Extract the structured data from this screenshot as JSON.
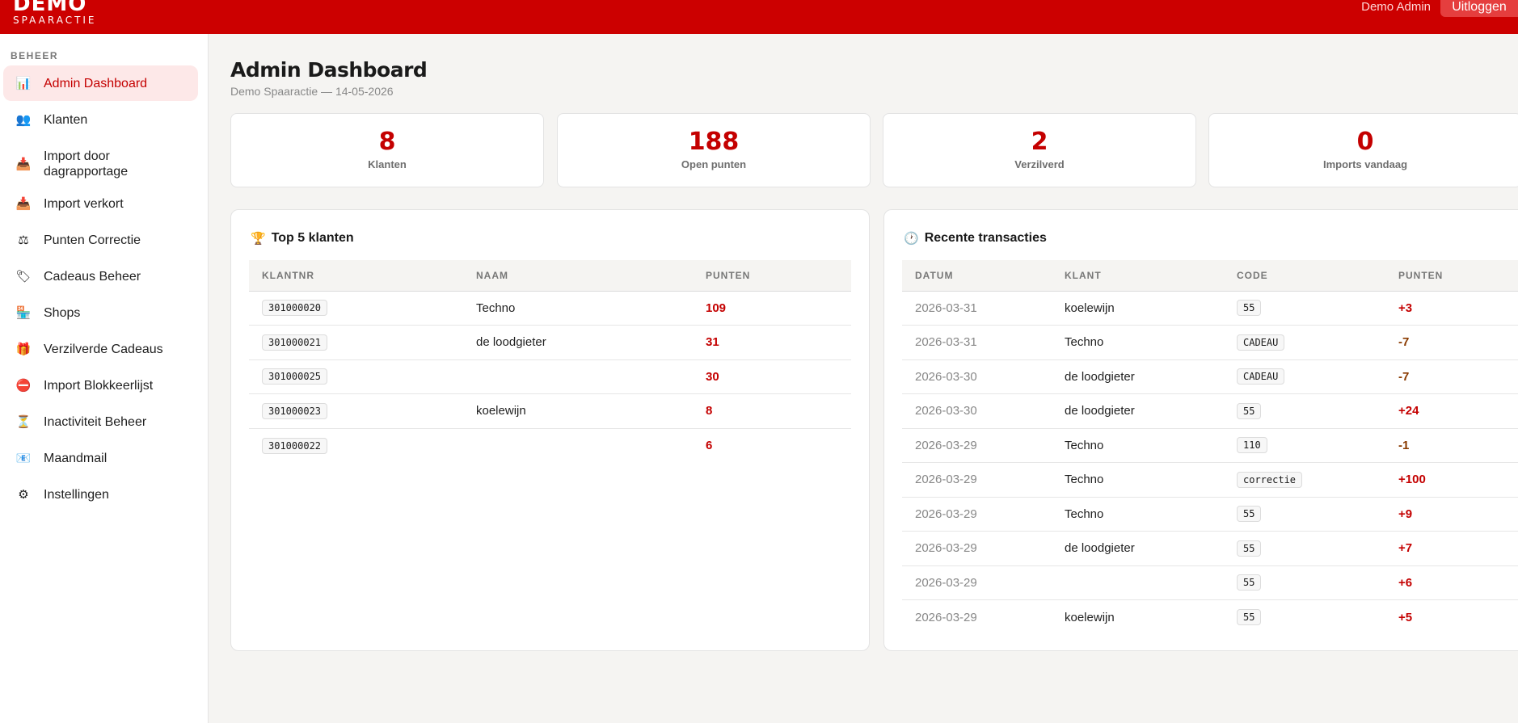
{
  "app": {
    "brand_name": "DEMO",
    "brand_subtitle": "SPAARACTIE",
    "user_name": "Demo Admin",
    "logout_label": "Uitloggen",
    "accent_color": "#cc0000"
  },
  "sidebar": {
    "heading": "BEHEER",
    "items": [
      {
        "label": "Admin Dashboard",
        "icon": "bar-chart-icon",
        "glyph": "📊",
        "active": true
      },
      {
        "label": "Klanten",
        "icon": "users-icon",
        "glyph": "👥"
      },
      {
        "label": "Import door dagrapportage",
        "icon": "inbox-tray-icon",
        "glyph": "📥"
      },
      {
        "label": "Import verkort",
        "icon": "inbox-tray-icon",
        "glyph": "📥"
      },
      {
        "label": "Punten Correctie",
        "icon": "balance-scale-icon",
        "glyph": "⚖"
      },
      {
        "label": "Cadeaus Beheer",
        "icon": "label-tag-icon",
        "glyph": "🏷"
      },
      {
        "label": "Shops",
        "icon": "shop-icon",
        "glyph": "🏪"
      },
      {
        "label": "Verzilverde Cadeaus",
        "icon": "gift-icon",
        "glyph": "🎁"
      },
      {
        "label": "Import Blokkeerlijst",
        "icon": "no-entry-icon",
        "glyph": "⛔"
      },
      {
        "label": "Inactiviteit Beheer",
        "icon": "hourglass-icon",
        "glyph": "⏳"
      },
      {
        "label": "Maandmail",
        "icon": "mail-icon",
        "glyph": "📧"
      },
      {
        "label": "Instellingen",
        "icon": "gear-icon",
        "glyph": "⚙"
      }
    ]
  },
  "page": {
    "title": "Admin Dashboard",
    "subtitle": "Demo Spaaractie — 14-05-2026"
  },
  "stats": [
    {
      "value": "8",
      "label": "Klanten"
    },
    {
      "value": "188",
      "label": "Open punten"
    },
    {
      "value": "2",
      "label": "Verzilverd"
    },
    {
      "value": "0",
      "label": "Imports vandaag"
    }
  ],
  "top_klanten": {
    "title": "Top 5 klanten",
    "icon": "trophy-icon",
    "columns": [
      "KLANTNR",
      "NAAM",
      "PUNTEN"
    ],
    "rows": [
      {
        "klantnr": "301000020",
        "naam": "Techno",
        "punten": "109"
      },
      {
        "klantnr": "301000021",
        "naam": "de loodgieter",
        "punten": "31"
      },
      {
        "klantnr": "301000025",
        "naam": "",
        "punten": "30"
      },
      {
        "klantnr": "301000023",
        "naam": "koelewijn",
        "punten": "8"
      },
      {
        "klantnr": "301000022",
        "naam": "",
        "punten": "6"
      }
    ]
  },
  "transacties": {
    "title": "Recente transacties",
    "icon": "clock-icon",
    "columns": [
      "DATUM",
      "KLANT",
      "CODE",
      "PUNTEN"
    ],
    "rows": [
      {
        "datum": "2026-03-31",
        "klant": "koelewijn",
        "code": "55",
        "punten": "+3"
      },
      {
        "datum": "2026-03-31",
        "klant": "Techno",
        "code": "CADEAU",
        "punten": "-7"
      },
      {
        "datum": "2026-03-30",
        "klant": "de loodgieter",
        "code": "CADEAU",
        "punten": "-7"
      },
      {
        "datum": "2026-03-30",
        "klant": "de loodgieter",
        "code": "55",
        "punten": "+24"
      },
      {
        "datum": "2026-03-29",
        "klant": "Techno",
        "code": "110",
        "punten": "-1"
      },
      {
        "datum": "2026-03-29",
        "klant": "Techno",
        "code": "correctie",
        "punten": "+100"
      },
      {
        "datum": "2026-03-29",
        "klant": "Techno",
        "code": "55",
        "punten": "+9"
      },
      {
        "datum": "2026-03-29",
        "klant": "de loodgieter",
        "code": "55",
        "punten": "+7"
      },
      {
        "datum": "2026-03-29",
        "klant": "",
        "code": "55",
        "punten": "+6"
      },
      {
        "datum": "2026-03-29",
        "klant": "koelewijn",
        "code": "55",
        "punten": "+5"
      }
    ]
  }
}
